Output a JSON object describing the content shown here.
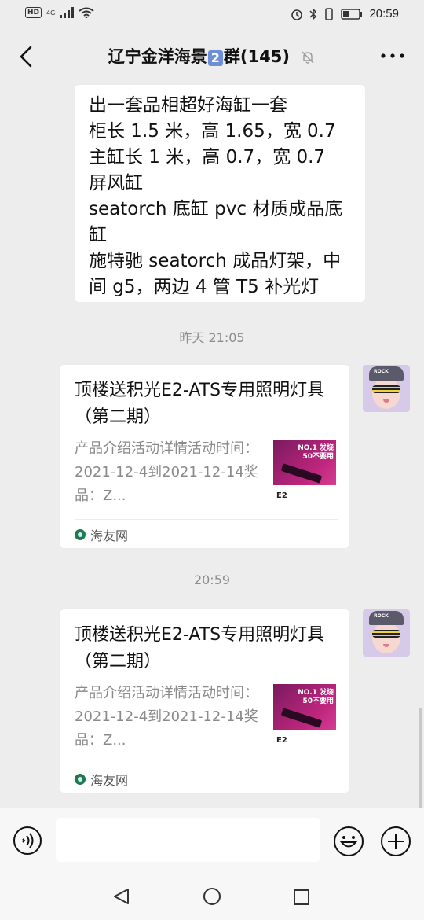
{
  "status_bar": {
    "time": "20:59",
    "network": "4G"
  },
  "header": {
    "title_prefix": "辽宁金洋海景",
    "title_badge": "2",
    "title_suffix": "群(145)"
  },
  "messages": {
    "text_message": {
      "lines": "出一套品相超好海缸一套\n柜长 1.5 米，高 1.65，宽 0.7\n主缸长 1 米，高 0.7，宽 0.7\n屏风缸\nseatorch 底缸 pvc 材质成品底缸\n施特驰 seatorch 成品灯架，中间 g5，两边 4 管 T5 补光灯"
    },
    "timestamp_1": "昨天 21:05",
    "card_1": {
      "title": "顶楼送积光E2-ATS专用照明灯具（第二期）",
      "description": "产品介绍活动详情活动时间：2021-12-4到2021-12-14奖品：Z...",
      "thumb_text_top": "NO.1 发烧\n50不要用",
      "thumb_text_bottom": "E2",
      "source": "海友网"
    },
    "timestamp_2": "20:59",
    "card_2": {
      "title": "顶楼送积光E2-ATS专用照明灯具（第二期）",
      "description": "产品介绍活动详情活动时间：2021-12-4到2021-12-14奖品：Z...",
      "thumb_text_top": "NO.1 发烧\n50不要用",
      "thumb_text_bottom": "E2",
      "source": "海友网"
    }
  },
  "avatar": {
    "hat_text": "ROCK"
  },
  "colors": {
    "background": "#ededed",
    "bubble": "#ffffff",
    "badge": "#6d8fd8",
    "timestamp": "#8c8c8c"
  }
}
